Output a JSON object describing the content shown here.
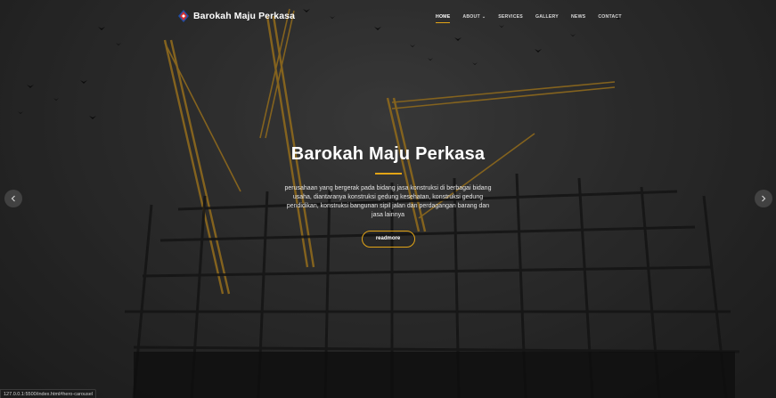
{
  "brand": {
    "name": "Barokah Maju Perkasa",
    "icon": "company-logo-icon"
  },
  "nav": {
    "items": [
      {
        "label": "HOME",
        "active": true
      },
      {
        "label": "ABOUT",
        "has_dropdown": true
      },
      {
        "label": "SERVICES"
      },
      {
        "label": "GALLERY"
      },
      {
        "label": "NEWS"
      },
      {
        "label": "CONTACT"
      }
    ]
  },
  "hero": {
    "title": "Barokah Maju Perkasa",
    "description": "perusahaan yang bergerak pada bidang jasa konstruksi di berbagai bidang usaha, diantaranya konstruksi gedung kesehatan, konstruksi gedung pendidikan, konstruksi bangunan sipil jalan dan perdagangan barang dan jasa lainnya",
    "button_label": "readmore",
    "prev_icon": "chevron-left-icon",
    "next_icon": "chevron-right-icon"
  },
  "statusbar": {
    "url": "127.0.0.1:5500/index.html#hero-carousel"
  },
  "colors": {
    "accent": "#e2a416",
    "text": "#ffffff",
    "overlay": "#000000"
  }
}
